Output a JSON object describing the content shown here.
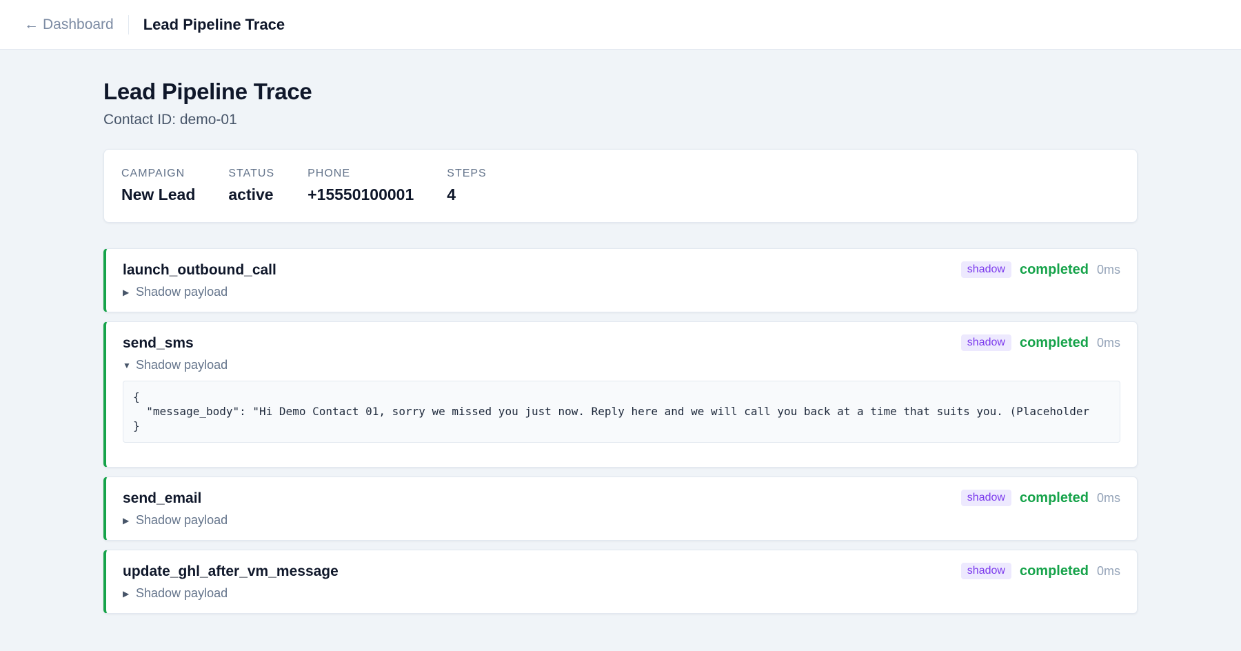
{
  "topbar": {
    "back_arrow": "←",
    "back_label": "Dashboard",
    "title": "Lead Pipeline Trace"
  },
  "page": {
    "title": "Lead Pipeline Trace",
    "subtitle": "Contact ID: demo-01"
  },
  "summary": {
    "campaign_label": "CAMPAIGN",
    "campaign_value": "New Lead",
    "status_label": "STATUS",
    "status_value": "active",
    "phone_label": "PHONE",
    "phone_value": "+15550100001",
    "steps_label": "STEPS",
    "steps_value": "4"
  },
  "colors": {
    "accent_success": "#16a34a",
    "badge_bg": "#ede9fe",
    "badge_fg": "#7c3aed"
  },
  "steps": [
    {
      "name": "launch_outbound_call",
      "badge": "shadow",
      "state": "completed",
      "duration": "0ms",
      "toggle_label": "Shadow payload",
      "caret": "▶"
    },
    {
      "name": "send_sms",
      "badge": "shadow",
      "state": "completed",
      "duration": "0ms",
      "toggle_label": "Shadow payload",
      "caret": "▼",
      "payload": "{\n  \"message_body\": \"Hi Demo Contact 01, sorry we missed you just now. Reply here and we will call you back at a time that suits you. (Placeholder\n}"
    },
    {
      "name": "send_email",
      "badge": "shadow",
      "state": "completed",
      "duration": "0ms",
      "toggle_label": "Shadow payload",
      "caret": "▶"
    },
    {
      "name": "update_ghl_after_vm_message",
      "badge": "shadow",
      "state": "completed",
      "duration": "0ms",
      "toggle_label": "Shadow payload",
      "caret": "▶"
    }
  ]
}
